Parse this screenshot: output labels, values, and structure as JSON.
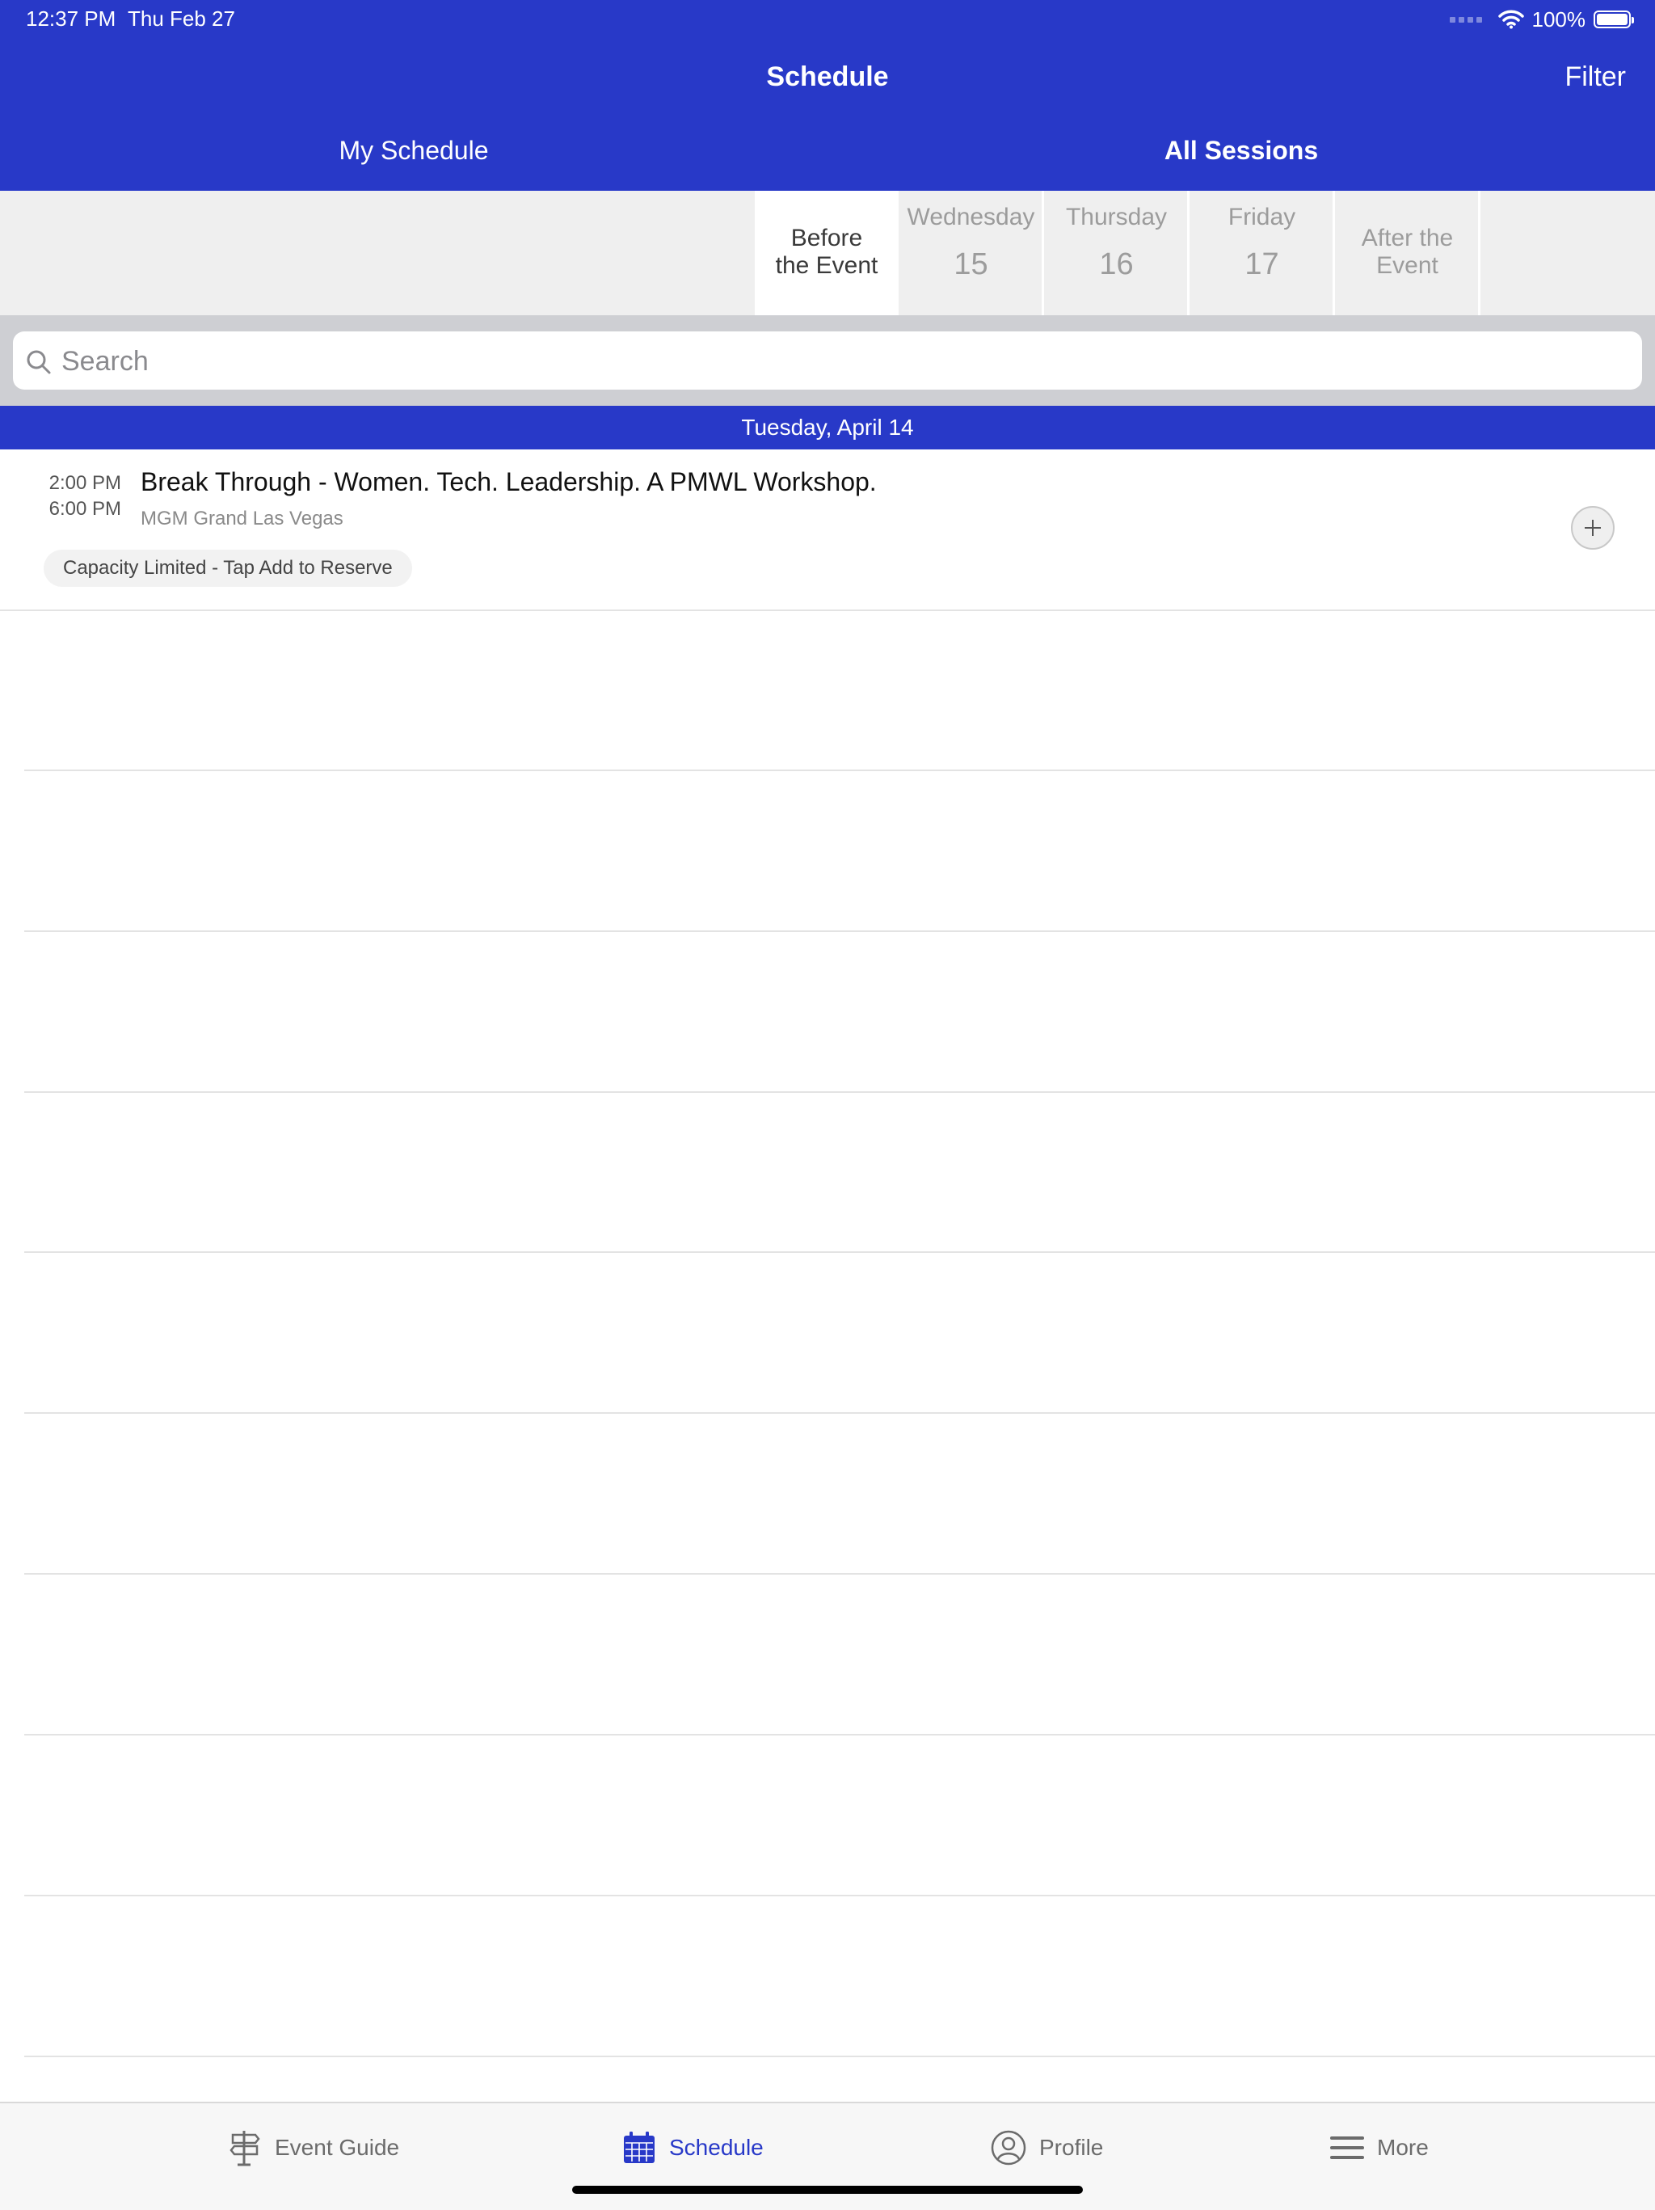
{
  "status_bar": {
    "time": "12:37 PM",
    "date": "Thu Feb 27",
    "battery_percent_label": "100%",
    "battery_level": 1.0
  },
  "nav": {
    "title": "Schedule",
    "filter_label": "Filter"
  },
  "segments": {
    "my_schedule": "My Schedule",
    "all_sessions": "All Sessions",
    "selected": "All Sessions"
  },
  "day_tabs": [
    {
      "label": "Before the Event",
      "line1": "Before",
      "line2": "the Event",
      "active": true
    },
    {
      "day": "Wednesday",
      "date": "15"
    },
    {
      "day": "Thursday",
      "date": "16"
    },
    {
      "day": "Friday",
      "date": "17"
    },
    {
      "label": "After the Event",
      "line1": "After the",
      "line2": "Event"
    }
  ],
  "search": {
    "placeholder": "Search",
    "value": ""
  },
  "date_header": "Tuesday, April 14",
  "sessions": [
    {
      "start": "2:00 PM",
      "end": "6:00 PM",
      "title": "Break Through - Women. Tech. Leadership. A PMWL Workshop.",
      "location": "MGM Grand Las Vegas",
      "badge": "Capacity Limited - Tap Add to Reserve"
    }
  ],
  "tab_bar": [
    {
      "label": "Event Guide",
      "icon": "signpost-icon"
    },
    {
      "label": "Schedule",
      "icon": "calendar-icon",
      "active": true
    },
    {
      "label": "Profile",
      "icon": "person-icon"
    },
    {
      "label": "More",
      "icon": "menu-icon"
    }
  ],
  "colors": {
    "brand": "#2839c8",
    "active_tab": "#2839c8"
  }
}
